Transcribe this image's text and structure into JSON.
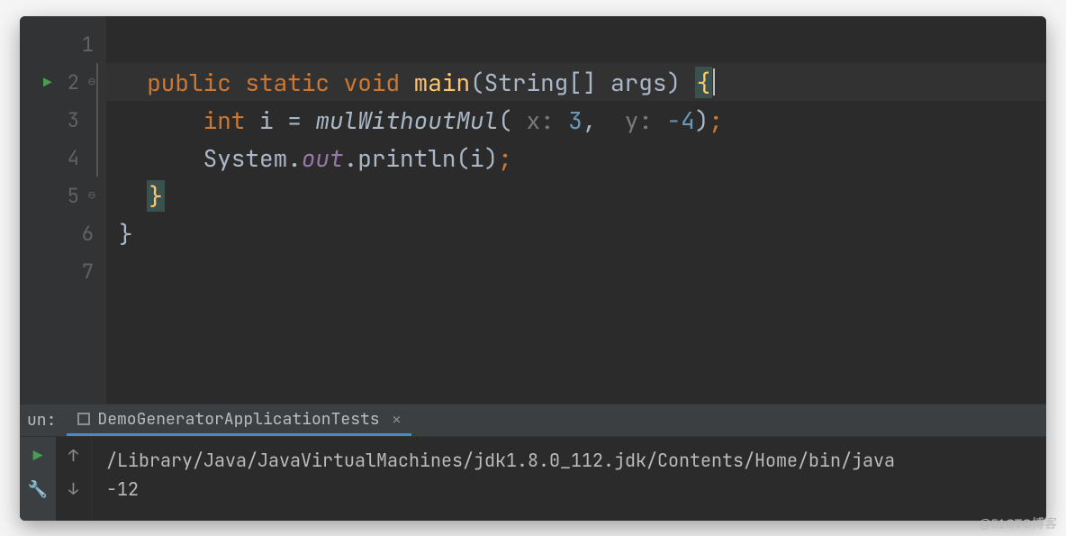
{
  "editor": {
    "lines": [
      "1",
      "2",
      "3",
      "4",
      "5",
      "6",
      "7"
    ],
    "code": {
      "l2": {
        "kw1": "public",
        "kw2": "static",
        "kw3": "void",
        "method": "main",
        "param": "(String[] args) ",
        "brace": "{"
      },
      "l3": {
        "indent": "    ",
        "type": "int",
        "assign": " i = ",
        "call": "mulWithoutMul",
        "open": "(",
        "hint1": " x: ",
        "arg1": "3",
        "comma": ",  ",
        "hint2": "y: ",
        "arg2": "-4",
        "close": ")",
        "semi": ";"
      },
      "l4": {
        "indent": "    ",
        "sys": "System.",
        "out": "out",
        "println": ".println(i)",
        "semi": ";"
      },
      "l5": {
        "brace": "}"
      },
      "l6": {
        "brace": "}"
      }
    }
  },
  "run": {
    "label": "un:",
    "tab_name": "DemoGeneratorApplicationTests",
    "console_line1": "/Library/Java/JavaVirtualMachines/jdk1.8.0_112.jdk/Contents/Home/bin/java",
    "console_line2": "-12"
  },
  "watermark": "@51CTO博客"
}
